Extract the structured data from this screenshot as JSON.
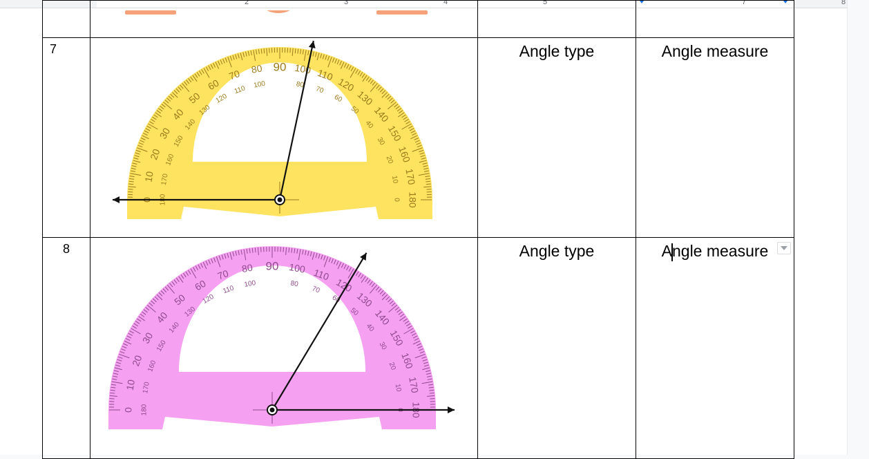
{
  "ruler": {
    "numbers": [
      "2",
      "3",
      "4",
      "5",
      "7",
      "8"
    ]
  },
  "rows": [
    {
      "number": "7",
      "angle_type_label": "Angle type",
      "angle_measure_label": "Angle measure",
      "protractor_color": "#fde360",
      "arms_angle_deg": [
        180,
        78
      ]
    },
    {
      "number": "8",
      "angle_type_label": "Angle type",
      "angle_measure_label_before_cursor": "A",
      "angle_measure_label_after_cursor": "ngle measure",
      "protractor_color": "#f6a0f2",
      "arms_angle_deg": [
        0,
        59
      ]
    }
  ],
  "protractor": {
    "outer_scale": [
      "0",
      "10",
      "20",
      "30",
      "40",
      "50",
      "60",
      "70",
      "80",
      "90",
      "100",
      "110",
      "120",
      "130",
      "140",
      "150",
      "160",
      "170",
      "180"
    ],
    "inner_scale": [
      "180",
      "170",
      "160",
      "150",
      "140",
      "130",
      "120",
      "110",
      "100",
      "90",
      "80",
      "70",
      "60",
      "50",
      "40",
      "30",
      "20",
      "10",
      "0"
    ]
  },
  "colors": {
    "ruler_marker": "#1a73e8",
    "previous_row_accent": "#f5a27a"
  }
}
